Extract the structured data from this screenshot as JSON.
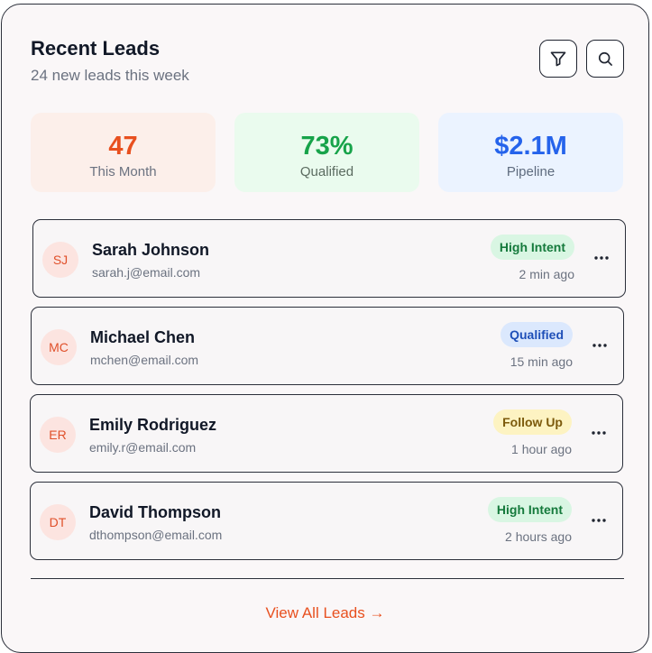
{
  "header": {
    "title": "Recent Leads",
    "subtitle": "24 new leads this week",
    "filter_icon": "filter-icon",
    "search_icon": "search-icon"
  },
  "stats": [
    {
      "value": "47",
      "label": "This Month",
      "color": "#e8501f"
    },
    {
      "value": "73%",
      "label": "Qualified",
      "color": "#17a34a"
    },
    {
      "value": "$2.1M",
      "label": "Pipeline",
      "color": "#2563eb"
    }
  ],
  "leads": [
    {
      "initials": "SJ",
      "name": "Sarah Johnson",
      "email": "sarah.j@email.com",
      "status": "High Intent",
      "time": "2 min ago"
    },
    {
      "initials": "MC",
      "name": "Michael Chen",
      "email": "mchen@email.com",
      "status": "Qualified",
      "time": "15 min ago"
    },
    {
      "initials": "ER",
      "name": "Emily Rodriguez",
      "email": "emily.r@email.com",
      "status": "Follow Up",
      "time": "1 hour ago"
    },
    {
      "initials": "DT",
      "name": "David Thompson",
      "email": "dthompson@email.com",
      "status": "High Intent",
      "time": "2 hours ago"
    }
  ],
  "footer": {
    "view_all": "View All Leads →"
  }
}
